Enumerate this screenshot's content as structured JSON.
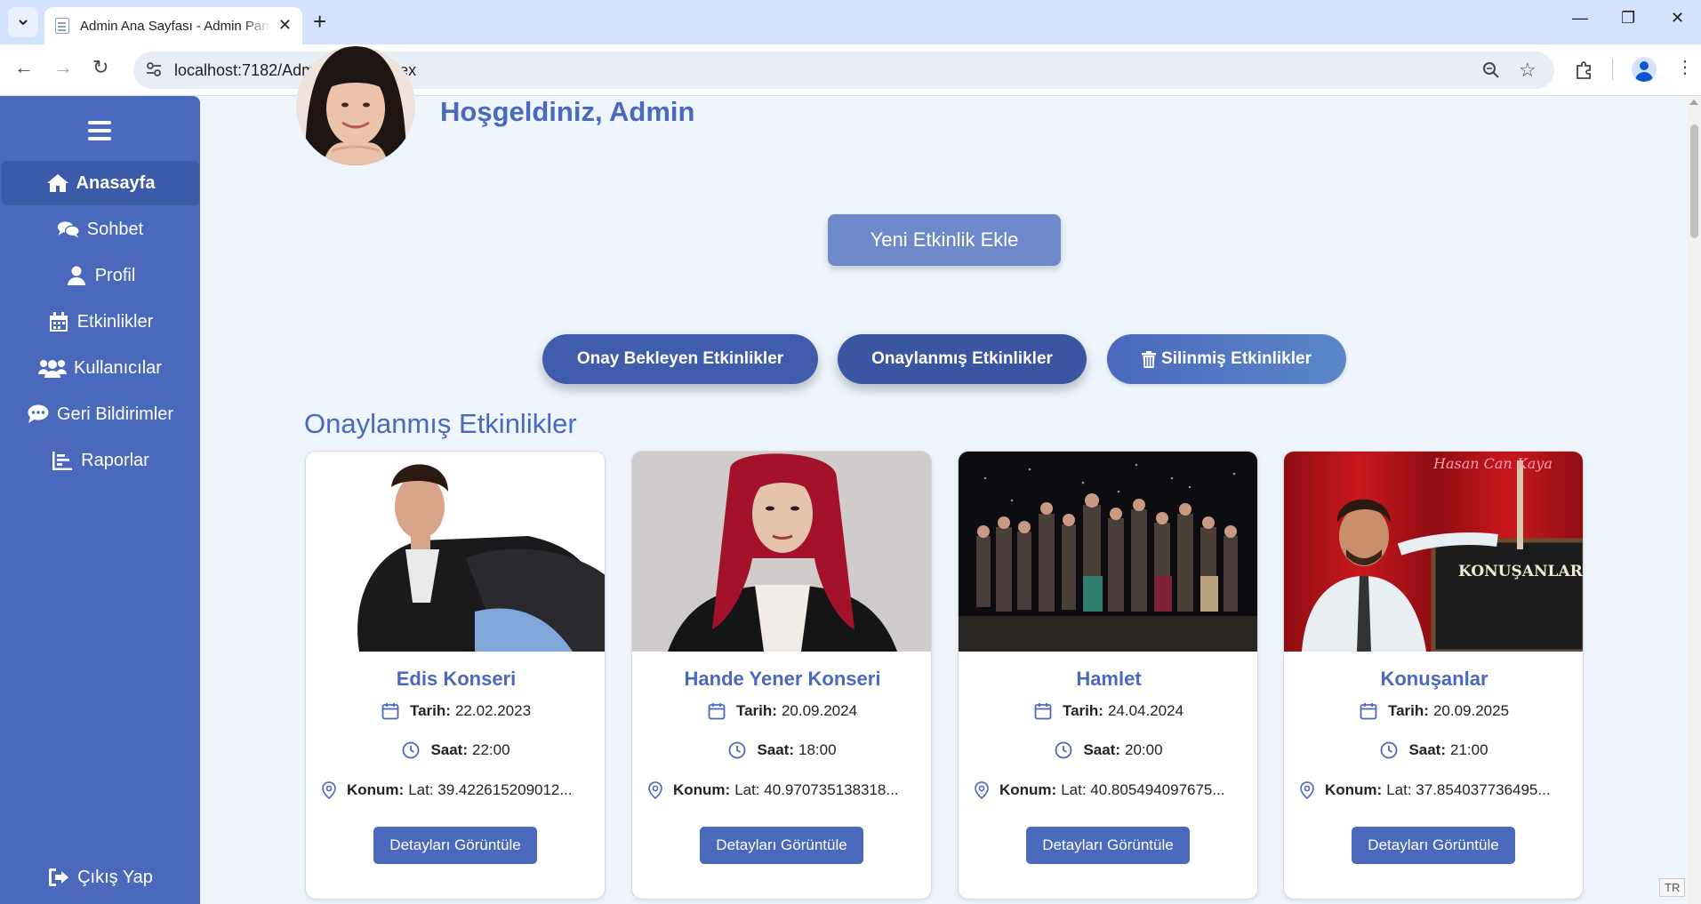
{
  "browser": {
    "tab_title": "Admin Ana Sayfası - Admin Panel",
    "url": "localhost:7182/Admin/AdminIndex",
    "ime_lang": "TR"
  },
  "sidebar": {
    "items": [
      {
        "label": "Anasayfa",
        "icon": "home-icon"
      },
      {
        "label": "Sohbet",
        "icon": "comments-icon"
      },
      {
        "label": "Profil",
        "icon": "user-icon"
      },
      {
        "label": "Etkinlikler",
        "icon": "calendar-icon"
      },
      {
        "label": "Kullanıcılar",
        "icon": "users-icon"
      },
      {
        "label": "Geri Bildirimler",
        "icon": "comment-dots-icon"
      },
      {
        "label": "Raporlar",
        "icon": "chart-icon"
      }
    ],
    "logout_label": "Çıkış Yap"
  },
  "header": {
    "welcome": "Hoşgeldiniz, Admin"
  },
  "actions": {
    "new_event": "Yeni Etkinlik Ekle",
    "pending": "Onay Bekleyen Etkinlikler",
    "approved": "Onaylanmış Etkinlikler",
    "deleted": "Silinmiş Etkinlikler"
  },
  "section_title": "Onaylanmış Etkinlikler",
  "labels": {
    "date": "Tarih:",
    "time": "Saat:",
    "location": "Konum:",
    "details": "Detayları Görüntüle"
  },
  "events": [
    {
      "title": "Edis Konseri",
      "date": "22.02.2023",
      "time": "22:00",
      "location": "Lat: 39.422615209012..."
    },
    {
      "title": "Hande Yener Konseri",
      "date": "20.09.2024",
      "time": "18:00",
      "location": "Lat: 40.970735138318..."
    },
    {
      "title": "Hamlet",
      "date": "24.04.2024",
      "time": "20:00",
      "location": "Lat: 40.805494097675..."
    },
    {
      "title": "Konuşanlar",
      "date": "20.09.2025",
      "time": "21:00",
      "location": "Lat: 37.854037736495...",
      "image_text": "Hasan Can Kaya",
      "sign_text": "KONUŞANLAR"
    }
  ],
  "colors": {
    "primary": "#4a69bd",
    "sidebar": "#4a69bd",
    "background": "#eef5fd"
  }
}
